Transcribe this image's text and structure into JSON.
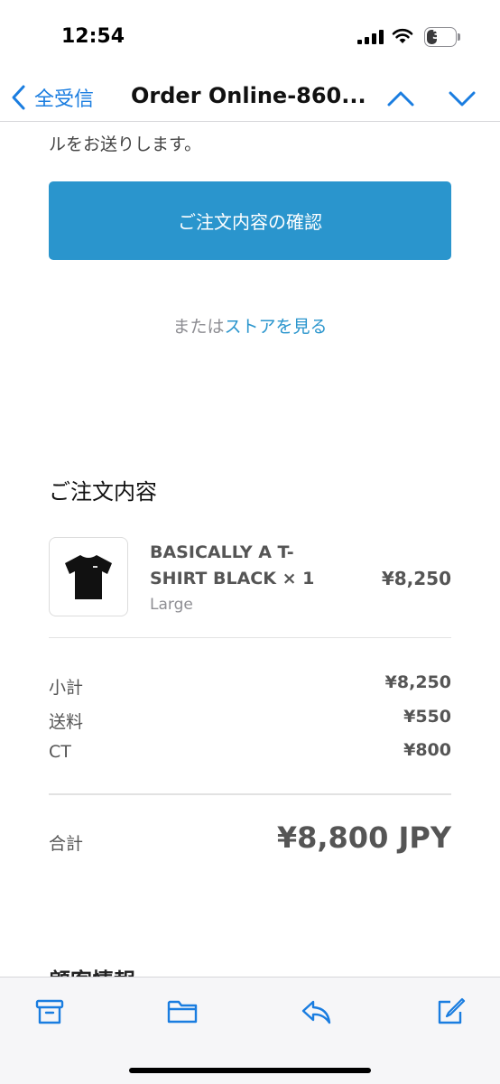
{
  "status_bar": {
    "time": "12:54",
    "battery": "35",
    "battery_level": 0.35,
    "icons": [
      "signal-icon",
      "wifi-icon",
      "battery-icon"
    ]
  },
  "nav": {
    "back_label": "全受信",
    "title": "Order Online-860...",
    "icons": [
      "chevron-left-icon",
      "chevron-up-icon",
      "chevron-down-icon"
    ]
  },
  "email": {
    "intro_tail": "ルをお送りします。",
    "confirm_button": "ご注文内容の確認",
    "store_prefix": "または",
    "store_link": "ストアを見る",
    "order_heading": "ご注文内容",
    "product": {
      "name": "BASICALLY A T-SHIRT BLACK × 1",
      "variant": "Large",
      "price": "¥8,250"
    },
    "summary": [
      {
        "label": "小計",
        "value": "¥8,250"
      },
      {
        "label": "送料",
        "value": "¥550"
      },
      {
        "label": "CT",
        "value": "¥800"
      }
    ],
    "total_label": "合計",
    "total_value": "¥8,800 JPY",
    "next_heading": "顧客情報"
  },
  "toolbar": {
    "icons": [
      "archive-icon",
      "folder-icon",
      "reply-icon",
      "compose-icon"
    ]
  },
  "colors": {
    "accent": "#2a95cd",
    "ios_blue": "#1a7de0"
  }
}
